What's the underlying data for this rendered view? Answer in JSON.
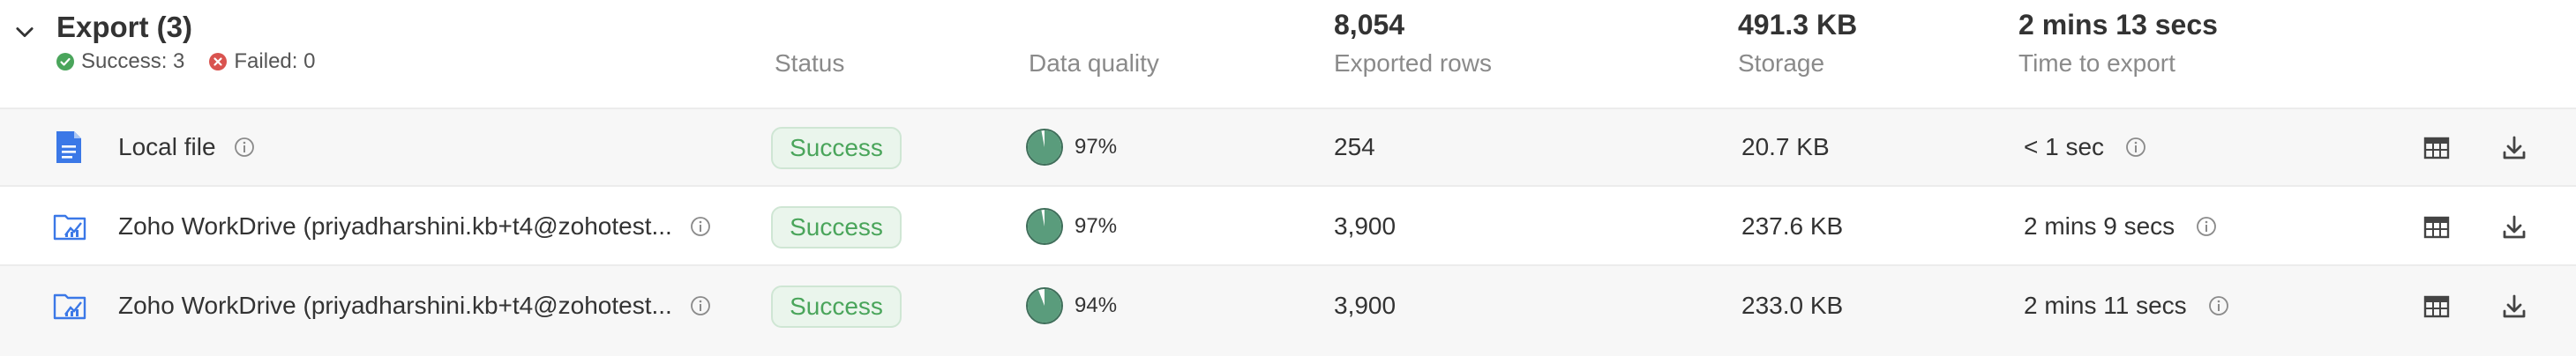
{
  "header": {
    "title": "Export (3)",
    "success_text": "Success: 3",
    "failed_text": "Failed: 0",
    "columns": {
      "status": "Status",
      "data_quality": "Data quality",
      "exported_rows_label": "Exported rows",
      "exported_rows_value": "8,054",
      "storage_label": "Storage",
      "storage_value": "491.3 KB",
      "time_label": "Time to export",
      "time_value": "2 mins 13 secs"
    }
  },
  "rows": [
    {
      "icon": "file-doc-icon",
      "name": "Local file",
      "status": "Success",
      "quality": "97%",
      "quality_value": 0.97,
      "rows": "254",
      "storage": "20.7 KB",
      "time": "< 1 sec"
    },
    {
      "icon": "workdrive-folder-icon",
      "name": "Zoho WorkDrive (priyadharshini.kb+t4@zohotest...",
      "status": "Success",
      "quality": "97%",
      "quality_value": 0.97,
      "rows": "3,900",
      "storage": "237.6 KB",
      "time": "2 mins 9 secs"
    },
    {
      "icon": "workdrive-folder-icon",
      "name": "Zoho WorkDrive (priyadharshini.kb+t4@zohotest...",
      "status": "Success",
      "quality": "94%",
      "quality_value": 0.94,
      "rows": "3,900",
      "storage": "233.0 KB",
      "time": "2 mins 11 secs"
    }
  ],
  "colors": {
    "success_green": "#4aa55b",
    "quality_green": "#5a9c7c",
    "doc_blue": "#3b78e7",
    "failed_red": "#d9534f"
  }
}
